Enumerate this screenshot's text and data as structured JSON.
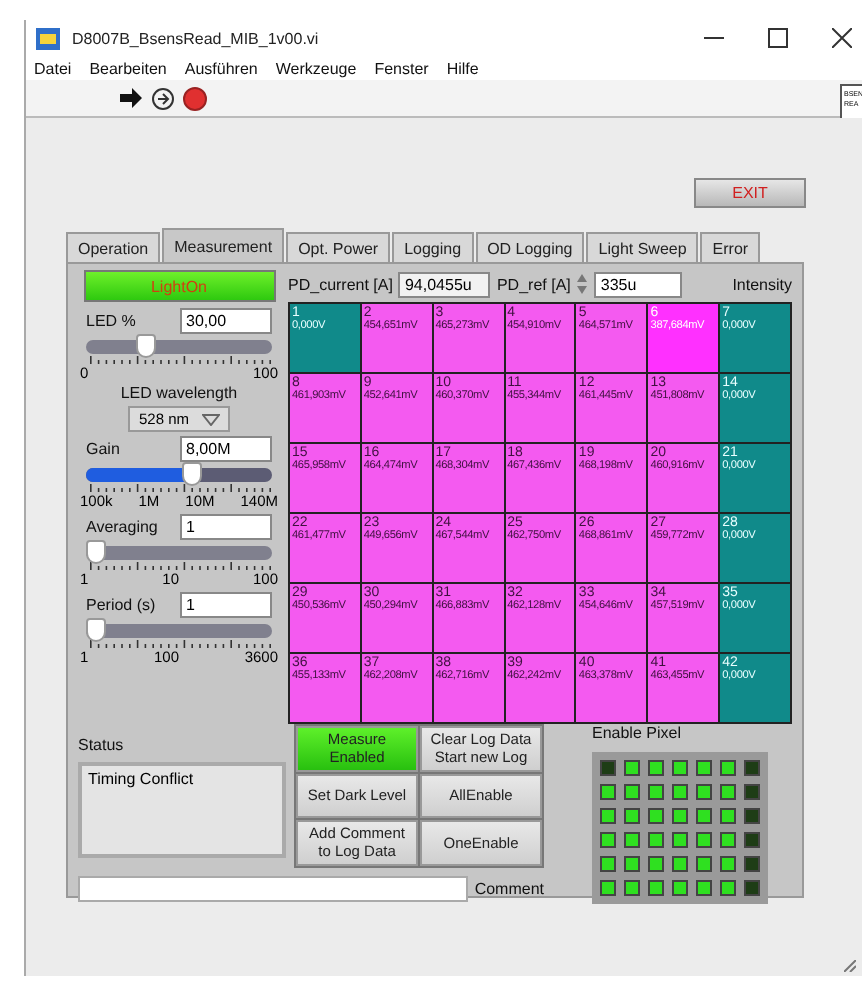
{
  "window": {
    "title": "D8007B_BsensRead_MIB_1v00.vi"
  },
  "menu": [
    "Datei",
    "Bearbeiten",
    "Ausführen",
    "Werkzeuge",
    "Fenster",
    "Hilfe"
  ],
  "connector_pane": [
    "BSEN",
    "REA"
  ],
  "exit_button": "EXIT",
  "tabs": [
    {
      "label": "Operation",
      "selected": false
    },
    {
      "label": "Measurement",
      "selected": true
    },
    {
      "label": "Opt. Power",
      "selected": false
    },
    {
      "label": "Logging",
      "selected": false
    },
    {
      "label": "OD Logging",
      "selected": false
    },
    {
      "label": "Light Sweep",
      "selected": false
    },
    {
      "label": "Error",
      "selected": false
    }
  ],
  "light_button": {
    "label": "LightOn",
    "on": true
  },
  "sliders": [
    {
      "label": "LED %",
      "value": "30,00",
      "level": 0.3,
      "fill": false,
      "scale": [
        "0",
        "100"
      ]
    },
    {
      "label": "Gain",
      "value": "8,00M",
      "level": 0.58,
      "fill": true,
      "scale": [
        "100k",
        "1M",
        "10M",
        "140M"
      ]
    },
    {
      "label": "Averaging",
      "value": "1",
      "level": 0,
      "fill": false,
      "scale": [
        "1",
        "10",
        "100"
      ]
    },
    {
      "label": "Period (s)",
      "value": "1",
      "level": 0,
      "fill": false,
      "scale": [
        "1",
        "100",
        "3600"
      ]
    }
  ],
  "led_wavelength": {
    "label": "LED wavelength",
    "value": "528 nm"
  },
  "pd_current": {
    "label": "PD_current [A]",
    "value": "94,0455u"
  },
  "pd_ref": {
    "label": "PD_ref [A]",
    "value": "335u"
  },
  "intensity_label": "Intensity",
  "cells": [
    {
      "n": "1",
      "v": "0,000V",
      "enabled": false,
      "selected": false
    },
    {
      "n": "2",
      "v": "454,651mV",
      "enabled": true,
      "selected": false
    },
    {
      "n": "3",
      "v": "465,273mV",
      "enabled": true,
      "selected": false
    },
    {
      "n": "4",
      "v": "454,910mV",
      "enabled": true,
      "selected": false
    },
    {
      "n": "5",
      "v": "464,571mV",
      "enabled": true,
      "selected": false
    },
    {
      "n": "6",
      "v": "387,684mV",
      "enabled": true,
      "selected": true
    },
    {
      "n": "7",
      "v": "0,000V",
      "enabled": false,
      "selected": false
    },
    {
      "n": "8",
      "v": "461,903mV",
      "enabled": true,
      "selected": false
    },
    {
      "n": "9",
      "v": "452,641mV",
      "enabled": true,
      "selected": false
    },
    {
      "n": "10",
      "v": "460,370mV",
      "enabled": true,
      "selected": false
    },
    {
      "n": "11",
      "v": "455,344mV",
      "enabled": true,
      "selected": false
    },
    {
      "n": "12",
      "v": "461,445mV",
      "enabled": true,
      "selected": false
    },
    {
      "n": "13",
      "v": "451,808mV",
      "enabled": true,
      "selected": false
    },
    {
      "n": "14",
      "v": "0,000V",
      "enabled": false,
      "selected": false
    },
    {
      "n": "15",
      "v": "465,958mV",
      "enabled": true,
      "selected": false
    },
    {
      "n": "16",
      "v": "464,474mV",
      "enabled": true,
      "selected": false
    },
    {
      "n": "17",
      "v": "468,304mV",
      "enabled": true,
      "selected": false
    },
    {
      "n": "18",
      "v": "467,436mV",
      "enabled": true,
      "selected": false
    },
    {
      "n": "19",
      "v": "468,198mV",
      "enabled": true,
      "selected": false
    },
    {
      "n": "20",
      "v": "460,916mV",
      "enabled": true,
      "selected": false
    },
    {
      "n": "21",
      "v": "0,000V",
      "enabled": false,
      "selected": false
    },
    {
      "n": "22",
      "v": "461,477mV",
      "enabled": true,
      "selected": false
    },
    {
      "n": "23",
      "v": "449,656mV",
      "enabled": true,
      "selected": false
    },
    {
      "n": "24",
      "v": "467,544mV",
      "enabled": true,
      "selected": false
    },
    {
      "n": "25",
      "v": "462,750mV",
      "enabled": true,
      "selected": false
    },
    {
      "n": "26",
      "v": "468,861mV",
      "enabled": true,
      "selected": false
    },
    {
      "n": "27",
      "v": "459,772mV",
      "enabled": true,
      "selected": false
    },
    {
      "n": "28",
      "v": "0,000V",
      "enabled": false,
      "selected": false
    },
    {
      "n": "29",
      "v": "450,536mV",
      "enabled": true,
      "selected": false
    },
    {
      "n": "30",
      "v": "450,294mV",
      "enabled": true,
      "selected": false
    },
    {
      "n": "31",
      "v": "466,883mV",
      "enabled": true,
      "selected": false
    },
    {
      "n": "32",
      "v": "462,128mV",
      "enabled": true,
      "selected": false
    },
    {
      "n": "33",
      "v": "454,646mV",
      "enabled": true,
      "selected": false
    },
    {
      "n": "34",
      "v": "457,519mV",
      "enabled": true,
      "selected": false
    },
    {
      "n": "35",
      "v": "0,000V",
      "enabled": false,
      "selected": false
    },
    {
      "n": "36",
      "v": "455,133mV",
      "enabled": true,
      "selected": false
    },
    {
      "n": "37",
      "v": "462,208mV",
      "enabled": true,
      "selected": false
    },
    {
      "n": "38",
      "v": "462,716mV",
      "enabled": true,
      "selected": false
    },
    {
      "n": "39",
      "v": "462,242mV",
      "enabled": true,
      "selected": false
    },
    {
      "n": "40",
      "v": "463,378mV",
      "enabled": true,
      "selected": false
    },
    {
      "n": "41",
      "v": "463,455mV",
      "enabled": true,
      "selected": false
    },
    {
      "n": "42",
      "v": "0,000V",
      "enabled": false,
      "selected": false
    }
  ],
  "status": {
    "label": "Status",
    "text": "Timing Conflict"
  },
  "buttons": [
    {
      "label": "Measure Enabled",
      "on": true
    },
    {
      "label": "Clear Log Data Start new Log",
      "on": false
    },
    {
      "label": "Set Dark Level",
      "on": false
    },
    {
      "label": "AllEnable",
      "on": false
    },
    {
      "label": "Add Comment to Log Data",
      "on": false
    },
    {
      "label": "OneEnable",
      "on": false
    }
  ],
  "enable_pixel_label": "Enable Pixel",
  "comment": {
    "label": "Comment"
  }
}
